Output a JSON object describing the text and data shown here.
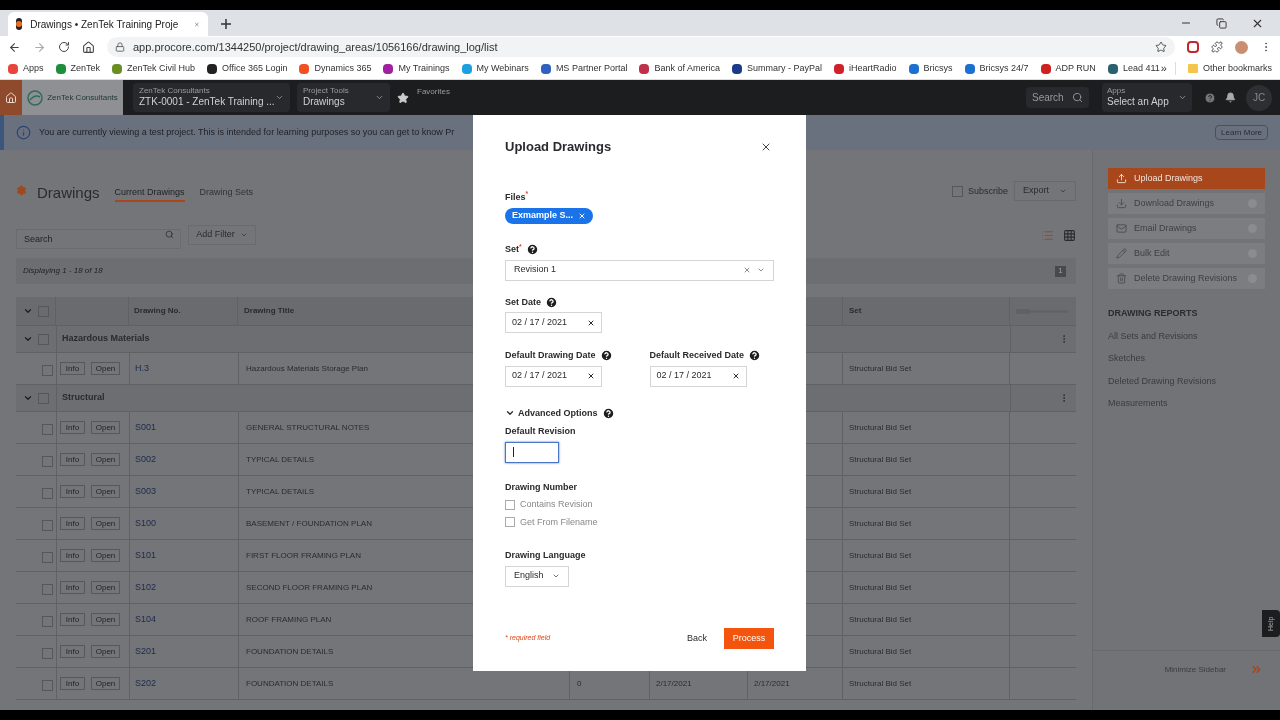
{
  "browser": {
    "tab_title": "Drawings • ZenTek Training Proje",
    "url": "app.procore.com/1344250/project/drawing_areas/1056166/drawing_log/list",
    "bookmarks": [
      "Apps",
      "ZenTek",
      "ZenTek Civil Hub",
      "Office 365 Login",
      "Dynamics 365",
      "My Trainings",
      "My Webinars",
      "MS Partner Portal",
      "Bank of America",
      "Summary - PayPal",
      "iHeartRadio",
      "Bricsys",
      "Bricsys 24/7",
      "ADP RUN",
      "Lead 411"
    ],
    "more": "»",
    "other_bookmarks": "Other bookmarks"
  },
  "header": {
    "logo_text": "ZenTek Consultants",
    "project": {
      "label": "ZenTek Consultants",
      "value": "ZTK-0001 - ZenTek Training ..."
    },
    "tool": {
      "label": "Project Tools",
      "value": "Drawings"
    },
    "favorites": "Favorites",
    "search": "Search",
    "apps": {
      "label": "Apps",
      "value": "Select an App"
    },
    "avatar": "JC"
  },
  "banner": {
    "text": "You are currently viewing a test project. This is intended for learning purposes so you can get to know Pr",
    "button": "Learn More"
  },
  "page": {
    "title": "Drawings",
    "tabs": [
      {
        "label": "Current Drawings",
        "selected": true
      },
      {
        "label": "Drawing Sets",
        "selected": false
      }
    ],
    "subscribe": {
      "label": "Subscribe",
      "checked": false
    },
    "export": "Export",
    "search_placeholder": "Search",
    "add_filter": "Add Filter",
    "views": [
      {
        "kind": "list",
        "selected": true
      },
      {
        "kind": "grid",
        "selected": false
      }
    ],
    "displaying": "Displaying 1 - 18 of 18",
    "page_number": "1"
  },
  "table": {
    "checked": false,
    "expanded": true,
    "columns": {
      "number": "Drawing No.",
      "title": "Drawing Title",
      "set": "Set"
    },
    "groups": [
      {
        "name": "Hazardous Materials",
        "expanded": true,
        "checked": false,
        "rows": [
          {
            "checked": false,
            "info": "Info",
            "open": "Open",
            "number": "H.3",
            "title": "Hazardous Materials Storage Plan",
            "set": "Structural Bid Set"
          }
        ]
      },
      {
        "name": "Structural",
        "expanded": true,
        "checked": false,
        "rows": [
          {
            "checked": false,
            "info": "Info",
            "open": "Open",
            "number": "S001",
            "title": "GENERAL STRUCTURAL NOTES",
            "set": "Structural Bid Set"
          },
          {
            "checked": false,
            "info": "Info",
            "open": "Open",
            "number": "S002",
            "title": "TYPICAL DETAILS",
            "set": "Structural Bid Set"
          },
          {
            "checked": false,
            "info": "Info",
            "open": "Open",
            "number": "S003",
            "title": "TYPICAL DETAILS",
            "set": "Structural Bid Set"
          },
          {
            "checked": false,
            "info": "Info",
            "open": "Open",
            "number": "S100",
            "title": "BASEMENT / FOUNDATION PLAN",
            "set": "Structural Bid Set"
          },
          {
            "checked": false,
            "info": "Info",
            "open": "Open",
            "number": "S101",
            "title": "FIRST FLOOR FRAMING PLAN",
            "set": "Structural Bid Set"
          },
          {
            "checked": false,
            "info": "Info",
            "open": "Open",
            "number": "S102",
            "title": "SECOND FLOOR FRAMING PLAN",
            "set": "Structural Bid Set"
          },
          {
            "checked": false,
            "info": "Info",
            "open": "Open",
            "number": "S104",
            "title": "ROOF FRAMING PLAN",
            "set": "Structural Bid Set"
          },
          {
            "checked": false,
            "info": "Info",
            "open": "Open",
            "number": "S201",
            "title": "FOUNDATION DETAILS",
            "set": "Structural Bid Set"
          },
          {
            "checked": false,
            "info": "Info",
            "open": "Open",
            "number": "S202",
            "title": "FOUNDATION DETAILS",
            "column_5": "0",
            "column_6": "2/17/2021",
            "column_7": "2/17/2021",
            "set": "Structural Bid Set"
          }
        ]
      }
    ]
  },
  "sidebar": {
    "actions": [
      {
        "kind": "upload",
        "label": "Upload Drawings",
        "disabled": false
      },
      {
        "kind": "download",
        "label": "Download Drawings",
        "disabled": true
      },
      {
        "kind": "email",
        "label": "Email Drawings",
        "disabled": true
      },
      {
        "kind": "edit",
        "label": "Bulk Edit",
        "disabled": true
      },
      {
        "kind": "delete",
        "label": "Delete Drawing Revisions",
        "disabled": true
      }
    ],
    "reports_title": "DRAWING REPORTS",
    "reports": [
      "All Sets and Revisions",
      "Sketches",
      "Deleted Drawing Revisions",
      "Measurements"
    ],
    "minimize": "Minimize Sidebar",
    "help": "Help"
  },
  "modal": {
    "title": "Upload Drawings",
    "files": {
      "label": "Files$^{*}$",
      "chip": "Exmample S..."
    },
    "set": {
      "label": "Set$^{*}$",
      "help": true,
      "value": "Revision 1"
    },
    "set_date": {
      "label": "Set Date",
      "help": true,
      "value": "02 / 17 / 2021"
    },
    "drawing_date": {
      "label": "Default Drawing Date",
      "help": true,
      "value": "02 / 17 / 2021"
    },
    "received_date": {
      "label": "Default Received Date",
      "help": true,
      "value": "02 / 17 / 2021"
    },
    "advanced": {
      "label": "Advanced Options",
      "help": true,
      "expanded": true
    },
    "default_revision": {
      "label": "Default Revision",
      "focused": true
    },
    "drawing_number": {
      "label": "Drawing Number",
      "options": [
        {
          "label": "Contains Revision",
          "checked": false
        },
        {
          "label": "Get From Filename",
          "checked": false
        }
      ]
    },
    "language": {
      "label": "Drawing Language",
      "value": "English"
    },
    "required_note": "* required field",
    "back": "Back",
    "process": "Process"
  }
}
